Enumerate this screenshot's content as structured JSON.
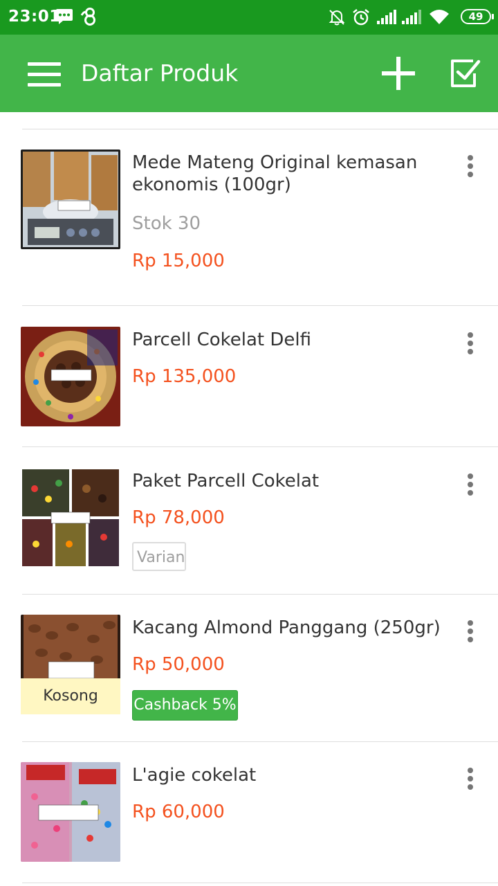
{
  "status_bar": {
    "time": "23:01",
    "battery": "49",
    "left_icons": [
      "message-icon",
      "infinity-icon"
    ],
    "right_icons": [
      "mute-icon",
      "alarm-icon",
      "signal-icon",
      "signal-icon",
      "wifi-icon",
      "battery-icon"
    ]
  },
  "appbar": {
    "title": "Daftar Produk",
    "menu_icon": "hamburger-menu-icon",
    "add_icon": "plus-icon",
    "select_icon": "checkbox-icon"
  },
  "products": [
    {
      "name": "Mede Mateng Original kemasan ekonomis (100gr)",
      "stock": "Stok 30",
      "price": "Rp 15,000"
    },
    {
      "name": "Parcell Cokelat Delfi",
      "price": "Rp 135,000"
    },
    {
      "name": "Paket Parcell Cokelat",
      "price": "Rp 78,000",
      "badge": "Varian"
    },
    {
      "name": "Kacang Almond Panggang (250gr)",
      "price": "Rp 50,000",
      "badge": "Cashback 5%",
      "overlay": "Kosong"
    },
    {
      "name": "L'agie cokelat",
      "price": "Rp 60,000"
    }
  ],
  "colors": {
    "status_bar": "#19991f",
    "app_bar": "#42b549",
    "price": "#f4511e",
    "cashback": "#42b549"
  }
}
